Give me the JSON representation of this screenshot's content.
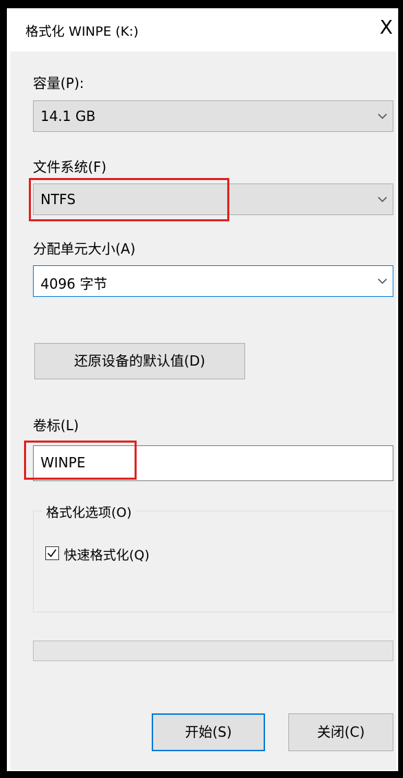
{
  "window": {
    "title": "格式化 WINPE (K:)",
    "close_glyph": "X"
  },
  "capacity": {
    "label": "容量(P):",
    "value": "14.1 GB"
  },
  "filesystem": {
    "label": "文件系统(F)",
    "value": "NTFS"
  },
  "allocation": {
    "label": "分配单元大小(A)",
    "value": "4096 字节"
  },
  "restore_defaults_label": "还原设备的默认值(D)",
  "volume_label": {
    "label": "卷标(L)",
    "value": "WINPE"
  },
  "format_options": {
    "legend": "格式化选项(O)",
    "quick_format_label": "快速格式化(Q)",
    "quick_format_checked": true
  },
  "progress": 0,
  "buttons": {
    "start": "开始(S)",
    "close": "关闭(C)"
  },
  "colors": {
    "highlight": "#e02020",
    "focus_accent": "#0078d7"
  },
  "icons": [
    "close-icon",
    "chevron-down-icon",
    "checkmark-icon"
  ]
}
